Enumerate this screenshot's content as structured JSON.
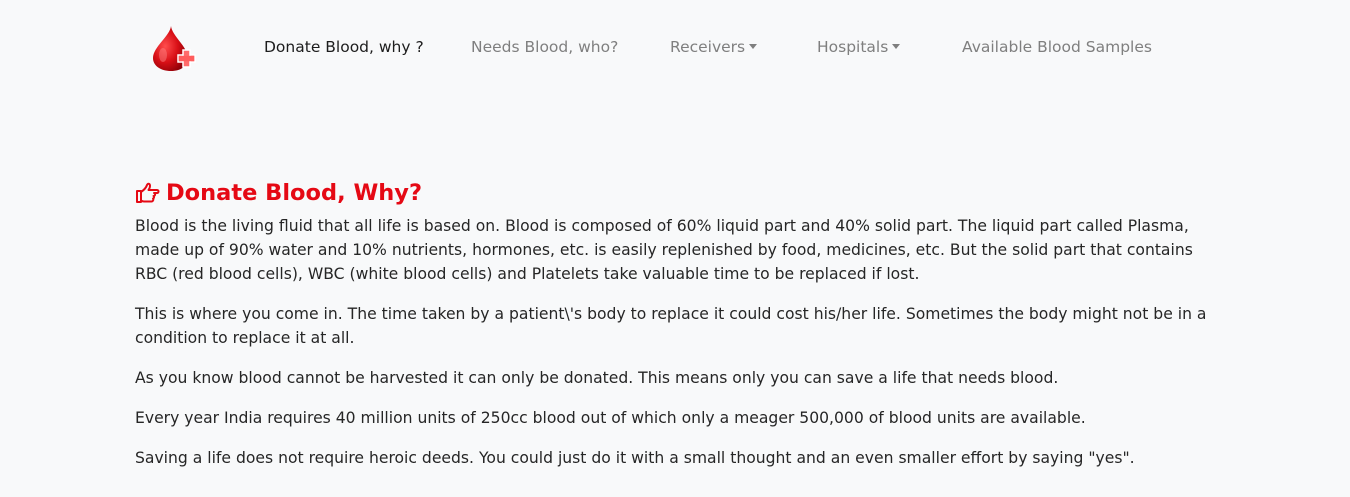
{
  "nav": {
    "logo_icon": "blood-drop-plus-icon",
    "items": [
      {
        "label": "Donate Blood, why ?",
        "active": true,
        "dropdown": false
      },
      {
        "label": "Needs Blood, who?",
        "active": false,
        "dropdown": false
      },
      {
        "label": "Receivers",
        "active": false,
        "dropdown": true
      },
      {
        "label": "Hospitals",
        "active": false,
        "dropdown": true
      },
      {
        "label": "Available Blood Samples",
        "active": false,
        "dropdown": false
      }
    ]
  },
  "main": {
    "title_icon": "hand-pointing-right-icon",
    "title": "Donate Blood, Why?",
    "paragraphs": [
      "Blood is the living fluid that all life is based on. Blood is composed of 60% liquid part and 40% solid part. The liquid part called Plasma, made up of 90% water and 10% nutrients, hormones, etc. is easily replenished by food, medicines, etc. But the solid part that contains RBC (red blood cells), WBC (white blood cells) and Platelets take valuable time to be replaced if lost.",
      "This is where you come in. The time taken by a patient\\'s body to replace it could cost his/her life. Sometimes the body might not be in a condition to replace it at all.",
      "As you know blood cannot be harvested it can only be donated. This means only you can save a life that needs blood.",
      "Every year India requires 40 million units of 250cc blood out of which only a meager 500,000 of blood units are available.",
      "Saving a life does not require heroic deeds. You could just do it with a small thought and an even smaller effort by saying \"yes\"."
    ]
  },
  "colors": {
    "accent": "#e50914",
    "nav_inactive": "#7f7f7f",
    "nav_active": "#1d1d1d",
    "background": "#f8f9fa"
  }
}
